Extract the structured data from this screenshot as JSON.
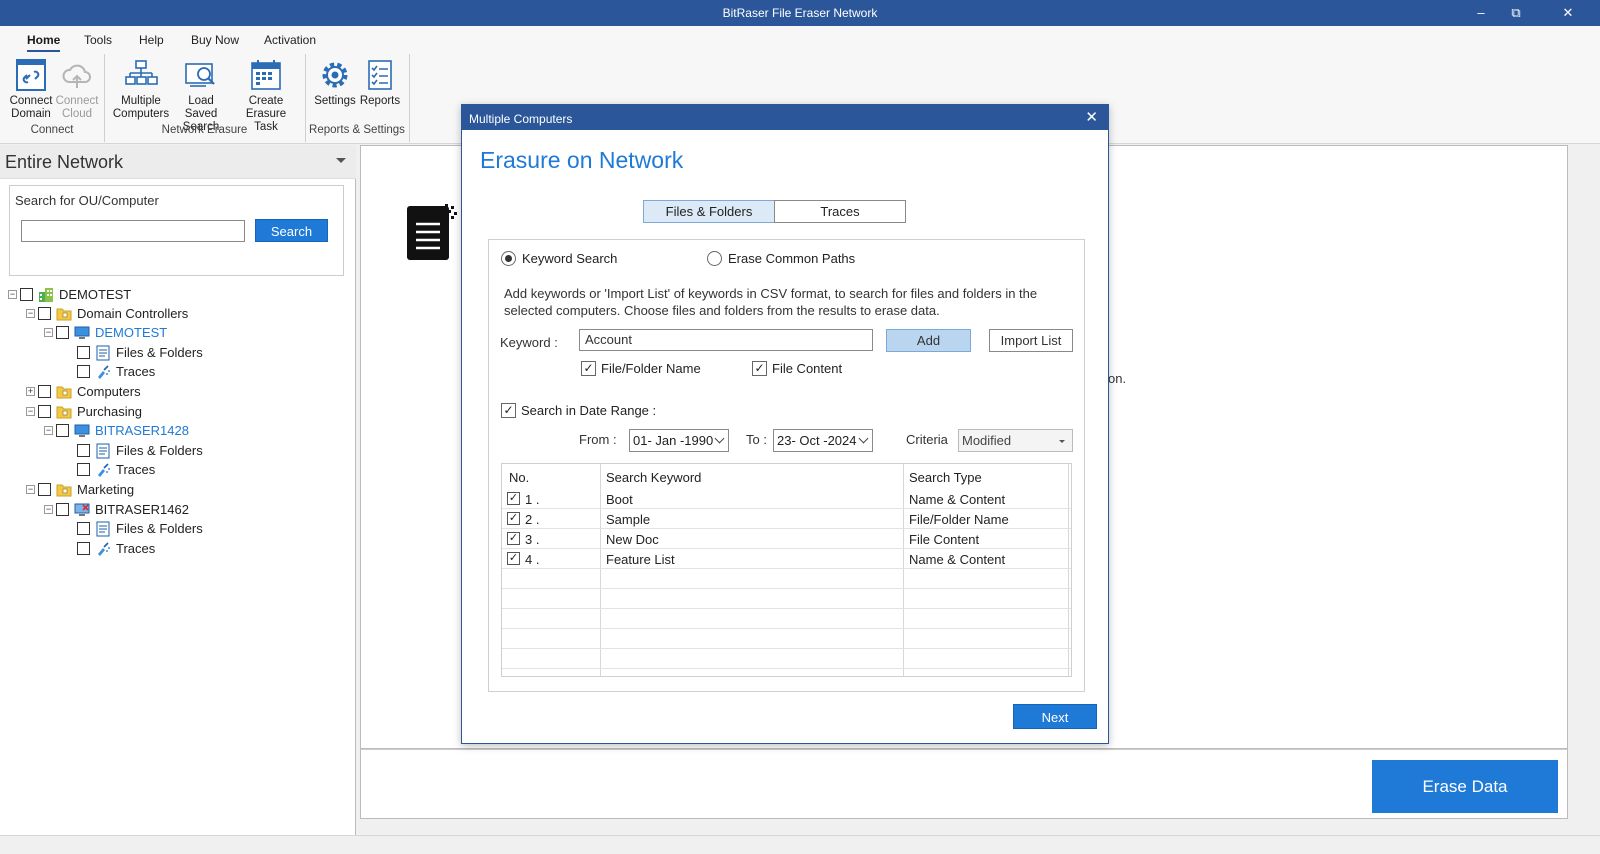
{
  "window": {
    "title": "BitRaser File Eraser Network",
    "minimize": "–",
    "restore": "⧉",
    "close": "✕"
  },
  "ribbon": {
    "tabs": [
      "Home",
      "Tools",
      "Help",
      "Buy Now",
      "Activation"
    ],
    "active_tab": "Home",
    "buttons": {
      "connect_domain": [
        "Connect",
        "Domain"
      ],
      "connect_cloud": [
        "Connect",
        "Cloud"
      ],
      "multiple_computers": [
        "Multiple",
        "Computers"
      ],
      "load_saved_search": [
        "Load Saved",
        "Search"
      ],
      "create_erasure_task": [
        "Create",
        "Erasure Task"
      ],
      "settings": "Settings",
      "reports": "Reports"
    },
    "groups": {
      "connect": "Connect",
      "network_erasure": "Network Erasure",
      "reports_settings": "Reports & Settings"
    }
  },
  "left_pane": {
    "header": "Entire Network",
    "search_label": "Search for OU/Computer",
    "search_value": "",
    "search_button": "Search",
    "tree": [
      {
        "label": "DEMOTEST",
        "icon": "domain-icon"
      },
      {
        "label": "Domain Controllers",
        "icon": "folder-icon"
      },
      {
        "label": "DEMOTEST",
        "icon": "computer-icon"
      },
      {
        "label": "Files & Folders",
        "icon": "files-icon"
      },
      {
        "label": "Traces",
        "icon": "traces-icon"
      },
      {
        "label": "Computers",
        "icon": "folder-icon"
      },
      {
        "label": "Purchasing",
        "icon": "folder-icon"
      },
      {
        "label": "BITRASER1428",
        "icon": "computer-icon"
      },
      {
        "label": "Files & Folders",
        "icon": "files-icon"
      },
      {
        "label": "Traces",
        "icon": "traces-icon"
      },
      {
        "label": "Marketing",
        "icon": "folder-icon"
      },
      {
        "label": "BITRASER1462",
        "icon": "computer-offline-icon"
      },
      {
        "label": "Files & Folders",
        "icon": "files-icon"
      },
      {
        "label": "Traces",
        "icon": "traces-icon"
      }
    ]
  },
  "main": {
    "background_text": "on.",
    "erase_button": "Erase Data"
  },
  "dialog": {
    "title": "Multiple Computers",
    "close": "✕",
    "heading": "Erasure on Network",
    "tabs": [
      "Files & Folders",
      "Traces"
    ],
    "active_tab": "Files & Folders",
    "radio_keyword": "Keyword Search",
    "radio_common": "Erase Common Paths",
    "description": "Add keywords or 'Import List' of keywords in CSV format, to search for files and folders in the selected computers. Choose files and folders from the results to erase data.",
    "keyword_label": "Keyword :",
    "keyword_value": "Account",
    "add_button": "Add",
    "import_button": "Import List",
    "chk_name": "File/Folder Name",
    "chk_content": "File Content",
    "chk_date": "Search in Date Range :",
    "from_label": "From :",
    "from_value": "01- Jan -1990",
    "to_label": "To :",
    "to_value": "23- Oct -2024",
    "criteria_label": "Criteria",
    "criteria_value": "Modified",
    "table": {
      "headers": [
        "No.",
        "Search Keyword",
        "Search Type"
      ],
      "rows": [
        {
          "no": "1 .",
          "keyword": "Boot",
          "type": "Name & Content"
        },
        {
          "no": "2 .",
          "keyword": "Sample",
          "type": "File/Folder Name"
        },
        {
          "no": "3 .",
          "keyword": "New Doc",
          "type": "File Content"
        },
        {
          "no": "4 .",
          "keyword": "Feature List",
          "type": "Name & Content"
        }
      ]
    },
    "next_button": "Next",
    "checkmark": "✓"
  },
  "colors": {
    "titlebar": "#2b579a",
    "accent": "#1e7ad6"
  }
}
